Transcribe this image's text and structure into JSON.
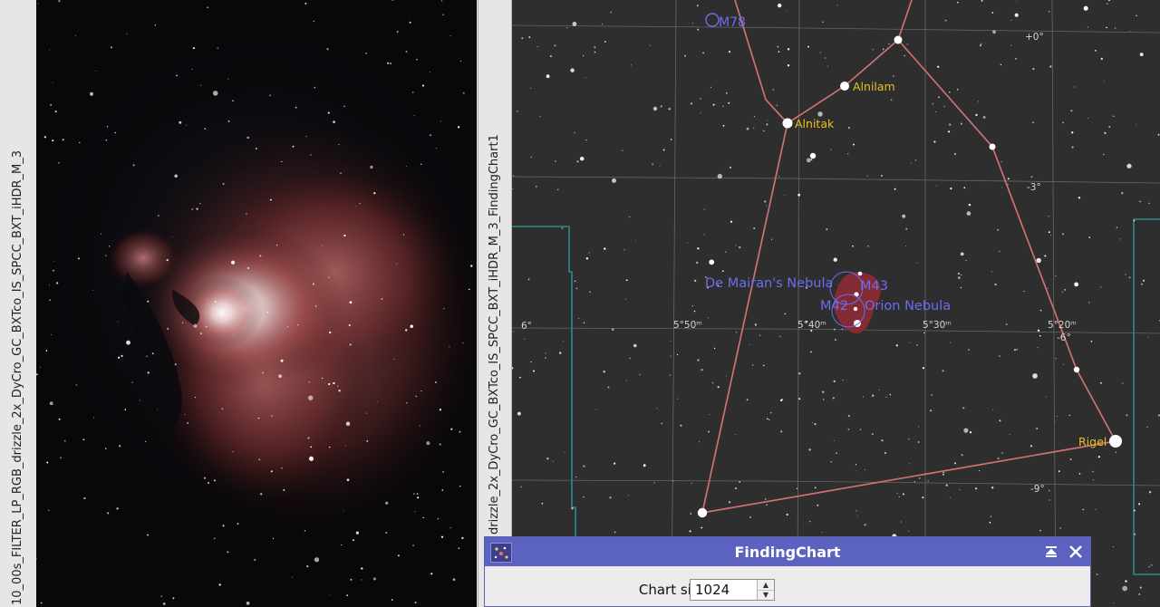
{
  "left_window": {
    "tab_title": "10_00s_FILTER_LP_RGB_drizzle_2x_DyCro_GC_BXTco_IS_SPCC_BXT_iHDR_M_3"
  },
  "right_window": {
    "tab_title": "drizzle_2x_DyCro_GC_BXTco_IS_SPCC_BXT_iHDR_M_3_FindingChart1"
  },
  "chart": {
    "star_labels": {
      "alnilam": "Alnilam",
      "alnitak": "Alnitak",
      "rigel": "Rigel"
    },
    "object_labels": {
      "m78": "M78",
      "de_mairan": "De Mairan's Nebula",
      "m43": "M43",
      "m42": "M42",
      "orion_nebula": "Orion Nebula"
    },
    "dec_labels": {
      "d0": "+0°",
      "d3": "-3°",
      "d6_left": "6°",
      "d6_right": "-6°",
      "d9": "-9°"
    },
    "ra_labels": {
      "r550": "5°50ᵐ",
      "r540": "5°40ᵐ",
      "r530": "5°30ᵐ",
      "r520": "5°20ᵐ"
    },
    "colors": {
      "constellation_line": "#d07070",
      "star_label": "#e8c020",
      "object_label": "#6a6ef0",
      "boundary": "#2a8a8a"
    }
  },
  "dialog": {
    "title": "FindingChart",
    "chart_size_label": "Chart size:",
    "chart_size_value": "1024"
  }
}
